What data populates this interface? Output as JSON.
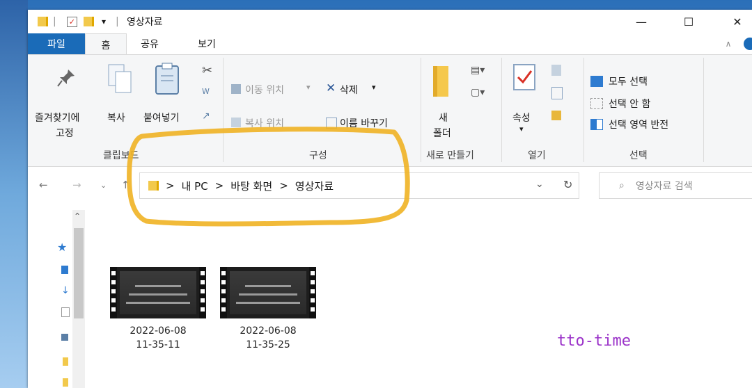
{
  "window": {
    "title": "영상자료"
  },
  "title_bar": {
    "quick_access_dropdown": "▾",
    "separator": "|"
  },
  "window_controls": {
    "minimize": "—",
    "maximize": "☐",
    "close": "✕"
  },
  "tabs": [
    {
      "label": "파일",
      "active": false
    },
    {
      "label": "홈",
      "active": true
    },
    {
      "label": "공유",
      "active": false
    },
    {
      "label": "보기",
      "active": false
    }
  ],
  "ribbon": {
    "clipboard": {
      "pin_label_1": "즐겨찾기에",
      "pin_label_2": "고정",
      "copy": "복사",
      "paste": "붙여넣기",
      "group": "클립보드"
    },
    "organize": {
      "move_to": "이동 위치",
      "delete": "삭제",
      "copy_to": "복사 위치",
      "rename": "이름 바꾸기",
      "group": "구성"
    },
    "new": {
      "new_folder_1": "새",
      "new_folder_2": "폴더",
      "group": "새로 만들기"
    },
    "open": {
      "properties": "속성",
      "group": "열기"
    },
    "select": {
      "select_all": "모두 선택",
      "select_none": "선택 안 함",
      "invert": "선택 영역 반전",
      "group": "선택"
    }
  },
  "address": {
    "crumbs": [
      "내 PC",
      "바탕 화면",
      "영상자료"
    ],
    "crumb_sep": ">",
    "search_placeholder": "영상자료 검색"
  },
  "files": [
    {
      "name_line1": "2022-06-08",
      "name_line2": "11-35-11"
    },
    {
      "name_line1": "2022-06-08",
      "name_line2": "11-35-25"
    }
  ],
  "watermark": "tto-time",
  "colors": {
    "accent": "#1a6bb8",
    "highlight": "#f0b323",
    "watermark": "#9b33c9"
  }
}
